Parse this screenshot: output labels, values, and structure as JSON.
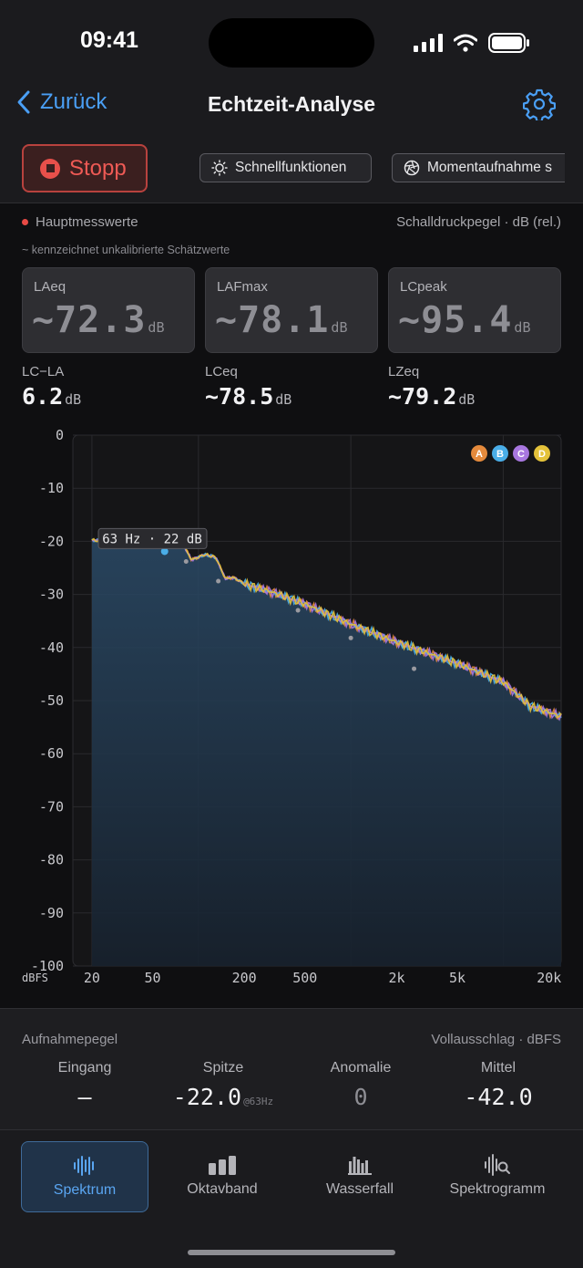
{
  "status_bar": {
    "time": "09:41"
  },
  "nav": {
    "back_label": "Zurück",
    "title": "Echtzeit-Analyse"
  },
  "toolbar": {
    "stop_label": "Stopp",
    "chips": [
      {
        "label": "Schnellfunktionen",
        "icon": "sun-icon"
      },
      {
        "label": "Momentaufnahme s",
        "icon": "aperture-icon"
      }
    ]
  },
  "main_values": {
    "heading": "Hauptmesswerte",
    "unit_label": "Schalldruckpegel · dB (rel.)",
    "note": "~ kennzeichnet unkalibrierte Schätzwerte",
    "cards": [
      {
        "label": "LAeq",
        "value": "~72.3",
        "unit": "dB"
      },
      {
        "label": "LAFmax",
        "value": "~78.1",
        "unit": "dB"
      },
      {
        "label": "LCpeak",
        "value": "~95.4",
        "unit": "dB"
      }
    ],
    "sub_values": [
      {
        "label": "LC−LA",
        "value": "6.2",
        "unit": "dB"
      },
      {
        "label": "LCeq",
        "value": "~78.5",
        "unit": "dB"
      },
      {
        "label": "LZeq",
        "value": "~79.2",
        "unit": "dB"
      }
    ]
  },
  "chart_data": {
    "type": "line",
    "x_scale": "log",
    "xlim": [
      15,
      24000
    ],
    "ylim": [
      -100,
      0
    ],
    "y_ticks": [
      0,
      -10,
      -20,
      -30,
      -40,
      -50,
      -60,
      -70,
      -80,
      -90,
      -100
    ],
    "x_ticks": [
      {
        "value": 20,
        "label": "20"
      },
      {
        "value": 50,
        "label": "50"
      },
      {
        "value": 200,
        "label": "200"
      },
      {
        "value": 500,
        "label": "500"
      },
      {
        "value": 2000,
        "label": "2k"
      },
      {
        "value": 5000,
        "label": "5k"
      },
      {
        "value": 20000,
        "label": "20k"
      }
    ],
    "grid_x": [
      20,
      100,
      1000,
      10000
    ],
    "y_unit_label": "dBFS",
    "tooltip": "63 Hz · 22 dB",
    "tooltip_freq": 63,
    "legend_placement": "top-right",
    "series": [
      {
        "name": "A",
        "color": "#e58a3c"
      },
      {
        "name": "B",
        "color": "#4aaee8"
      },
      {
        "name": "C",
        "color": "#a877e0"
      },
      {
        "name": "D",
        "color": "#e4c23a"
      }
    ],
    "reference_envelope": {
      "x": [
        20,
        40,
        55,
        65,
        75,
        90,
        110,
        130,
        150,
        170,
        200,
        300,
        500,
        1000,
        2000,
        5000,
        10000,
        15000,
        24000
      ],
      "y": [
        -19.8,
        -20.2,
        -19.5,
        -18.0,
        -19.2,
        -23.5,
        -22.5,
        -23.0,
        -27.0,
        -26.8,
        -28.0,
        -29.5,
        -31.8,
        -35.6,
        -39.0,
        -43.0,
        -46.5,
        -51.0,
        -53.0
      ]
    },
    "peak_dots": [
      {
        "x": 60,
        "y": -21.9
      },
      {
        "x": 83,
        "y": -23.8
      },
      {
        "x": 135,
        "y": -27.5
      },
      {
        "x": 450,
        "y": -33.0
      },
      {
        "x": 1000,
        "y": -38.2
      },
      {
        "x": 2600,
        "y": -44.0
      }
    ]
  },
  "recording_level": {
    "title": "Aufnahmepegel",
    "unit": "Vollausschlag · dBFS",
    "columns": [
      {
        "label": "Eingang",
        "value": "–"
      },
      {
        "label": "Spitze",
        "value": "-22.0",
        "at": "@63Hz"
      },
      {
        "label": "Anomalie",
        "value": "0"
      },
      {
        "label": "Mittel",
        "value": "-42.0"
      }
    ]
  },
  "tabs": [
    {
      "label": "Spektrum",
      "icon": "waveform-icon",
      "active": true
    },
    {
      "label": "Oktavband",
      "icon": "bars-icon",
      "active": false
    },
    {
      "label": "Wasserfall",
      "icon": "histogram-icon",
      "active": false
    },
    {
      "label": "Spektrogramm",
      "icon": "waveform-search-icon",
      "active": false
    }
  ]
}
